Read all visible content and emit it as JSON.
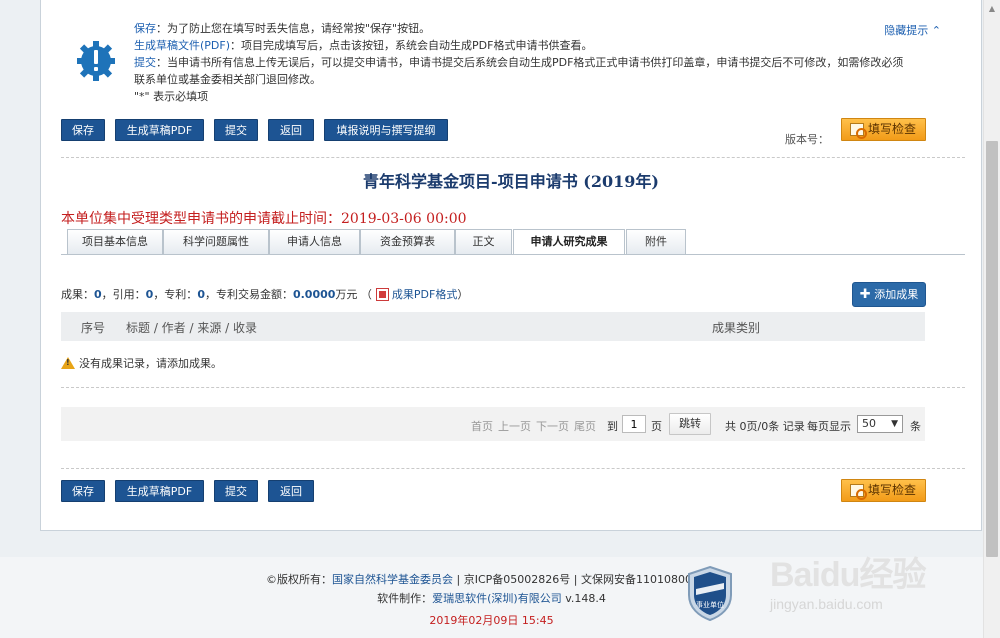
{
  "notice": {
    "save_label": "保存",
    "save_text": "：为了防止您在填写时丢失信息，请经常按\"保存\"按钮。",
    "draft_label": "生成草稿文件(PDF)",
    "draft_text": "：项目完成填写后，点击该按钮，系统会自动生成PDF格式申请书供查看。",
    "submit_label": "提交",
    "submit_text": "：当申请书所有信息上传无误后，可以提交申请书，申请书提交后系统会自动生成PDF格式正式申请书供打印盖章，申请书提交后不可修改，如需修改必须联系单位或基金委相关部门退回修改。",
    "required_mark": "\"*\"",
    "required_text": " 表示必填项",
    "hide_tip": "隐藏提示 ⌃"
  },
  "toolbar": {
    "save": "保存",
    "draft_pdf": "生成草稿PDF",
    "submit": "提交",
    "back": "返回",
    "guide": "填报说明与撰写提纲",
    "version_label": "版本号：",
    "check": "填写检查"
  },
  "title": "青年科学基金项目-项目申请书 (2019年)",
  "deadline": "本单位集中受理类型申请书的申请截止时间：2019-03-06 00:00",
  "tabs": [
    "项目基本信息",
    "科学问题属性",
    "申请人信息",
    "资金预算表",
    "正文",
    "申请人研究成果",
    "附件"
  ],
  "active_tab": "申请人研究成果",
  "stats": {
    "achievements_label": "成果：",
    "achievements": "0",
    "citations_label": "，引用：",
    "citations": "0",
    "patents_label": "，专利：",
    "patents": "0",
    "patent_amount_label": "，专利交易金额：",
    "patent_amount": "0.0000",
    "unit": "万元",
    "pdf_link": "成果PDF格式",
    "paren_open": "（",
    "paren_close": "）"
  },
  "add_button": "添加成果",
  "table": {
    "col_no": "序号",
    "col_title": "标题 / 作者 / 来源 / 收录",
    "col_type": "成果类别",
    "empty": "没有成果记录，请添加成果。"
  },
  "pager": {
    "first": "首页",
    "prev": "上一页",
    "next": "下一页",
    "last": "尾页",
    "to": "到",
    "page_value": "1",
    "page": "页",
    "jump": "跳转",
    "total": "共 0页/0条 记录",
    "per_page": "每页显示",
    "per_page_value": "50",
    "items": "条"
  },
  "footer": {
    "copyright_label": "©版权所有：",
    "owner": "国家自然科学基金委员会",
    "icp": " | 京ICP备05002826号 | 文保网安备1101080035号",
    "maker_label": "软件制作：",
    "maker": "爱瑞思软件(深圳)有限公司",
    "version": " v.148.4",
    "date": "2019年02月09日 15:45",
    "badge": "事业单位"
  },
  "watermark": {
    "brand": "Baidu经验",
    "url": "jingyan.baidu.com"
  },
  "colors": {
    "primary_button": "#1d5493",
    "accent_orange": "#f29b18",
    "deadline_red": "#c41f1f",
    "title_blue": "#1b3b6d"
  }
}
